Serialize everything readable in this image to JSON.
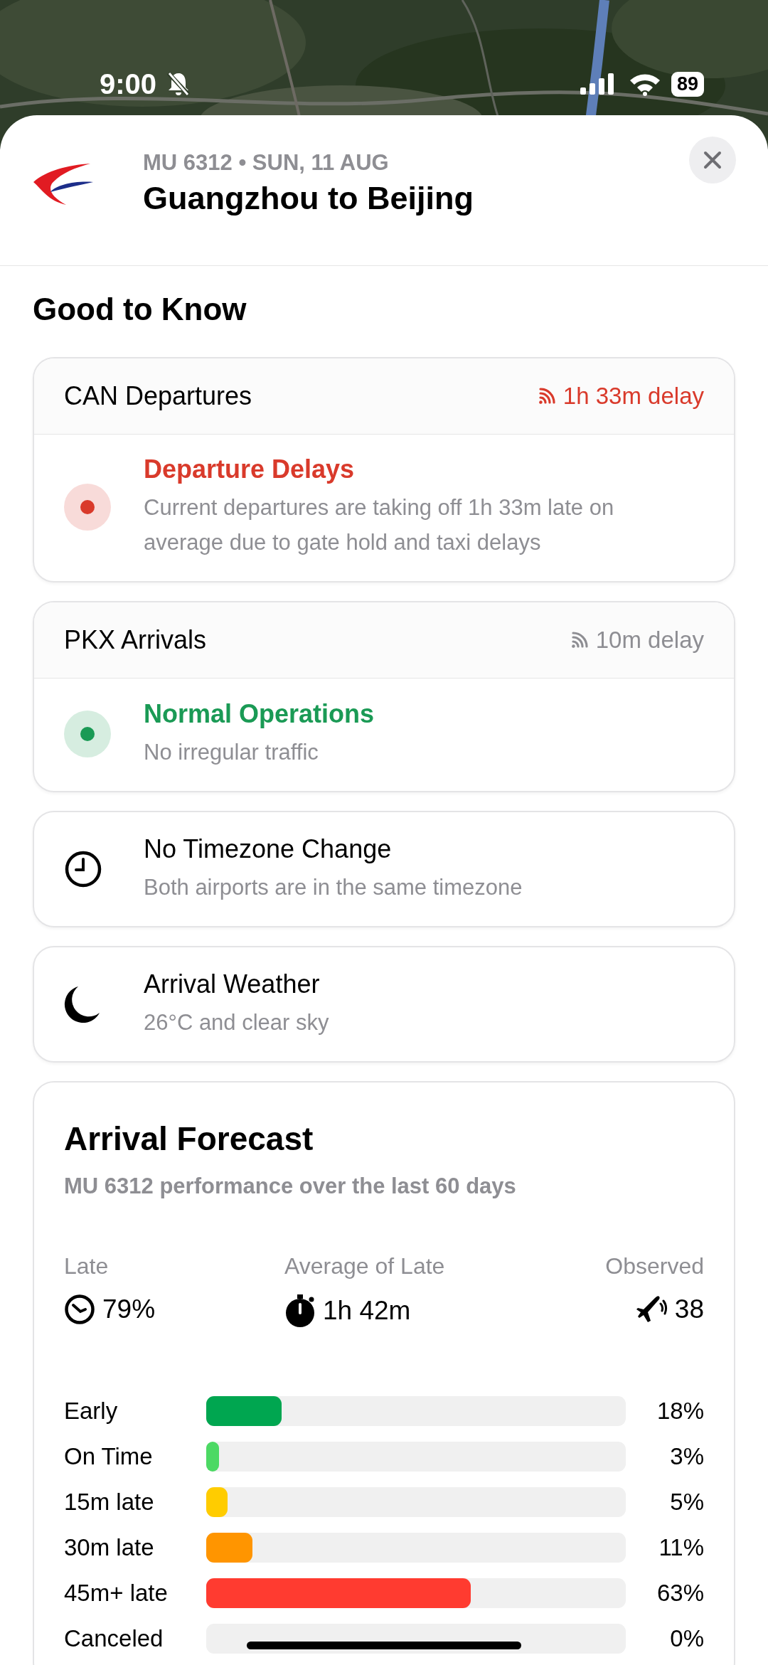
{
  "status_bar": {
    "time": "9:00",
    "battery": "89"
  },
  "header": {
    "subtitle": "MU 6312 • SUN, 11 AUG",
    "title": "Guangzhou to Beijing"
  },
  "section_title": "Good to Know",
  "alerts": [
    {
      "kind": "delay",
      "airport": "CAN Departures",
      "delay": "1h 33m delay",
      "status_title": "Departure Delays",
      "status_text": "Current departures are taking off 1h 33m late on average due to gate hold and taxi delays"
    },
    {
      "kind": "normal",
      "airport": "PKX Arrivals",
      "delay": "10m delay",
      "status_title": "Normal Operations",
      "status_text": "No irregular traffic"
    }
  ],
  "info": [
    {
      "kind": "clock",
      "title": "No Timezone Change",
      "text": "Both airports are in the same timezone"
    },
    {
      "kind": "moon",
      "title": "Arrival Weather",
      "text": "26°C and clear sky"
    }
  ],
  "forecast": {
    "title": "Arrival Forecast",
    "subtitle": "MU 6312 performance over the last 60 days",
    "stats": [
      {
        "kind": "late",
        "label": "Late",
        "value": "79%"
      },
      {
        "kind": "average",
        "label": "Average of Late",
        "value": "1h 42m"
      },
      {
        "kind": "observed",
        "label": "Observed",
        "value": "38"
      }
    ],
    "bars": [
      {
        "label": "Early",
        "level": 0.18,
        "value": "18%",
        "color": "#00a650"
      },
      {
        "label": "On Time",
        "level": 0.03,
        "value": "3%",
        "color": "#4cd964"
      },
      {
        "label": "15m late",
        "level": 0.05,
        "value": "5%",
        "color": "#ffcc00"
      },
      {
        "label": "30m late",
        "level": 0.11,
        "value": "11%",
        "color": "#ff9500"
      },
      {
        "label": "45m+ late",
        "level": 0.63,
        "value": "63%",
        "color": "#ff3b30"
      },
      {
        "label": "Canceled",
        "level": 0,
        "value": "0%"
      }
    ]
  }
}
